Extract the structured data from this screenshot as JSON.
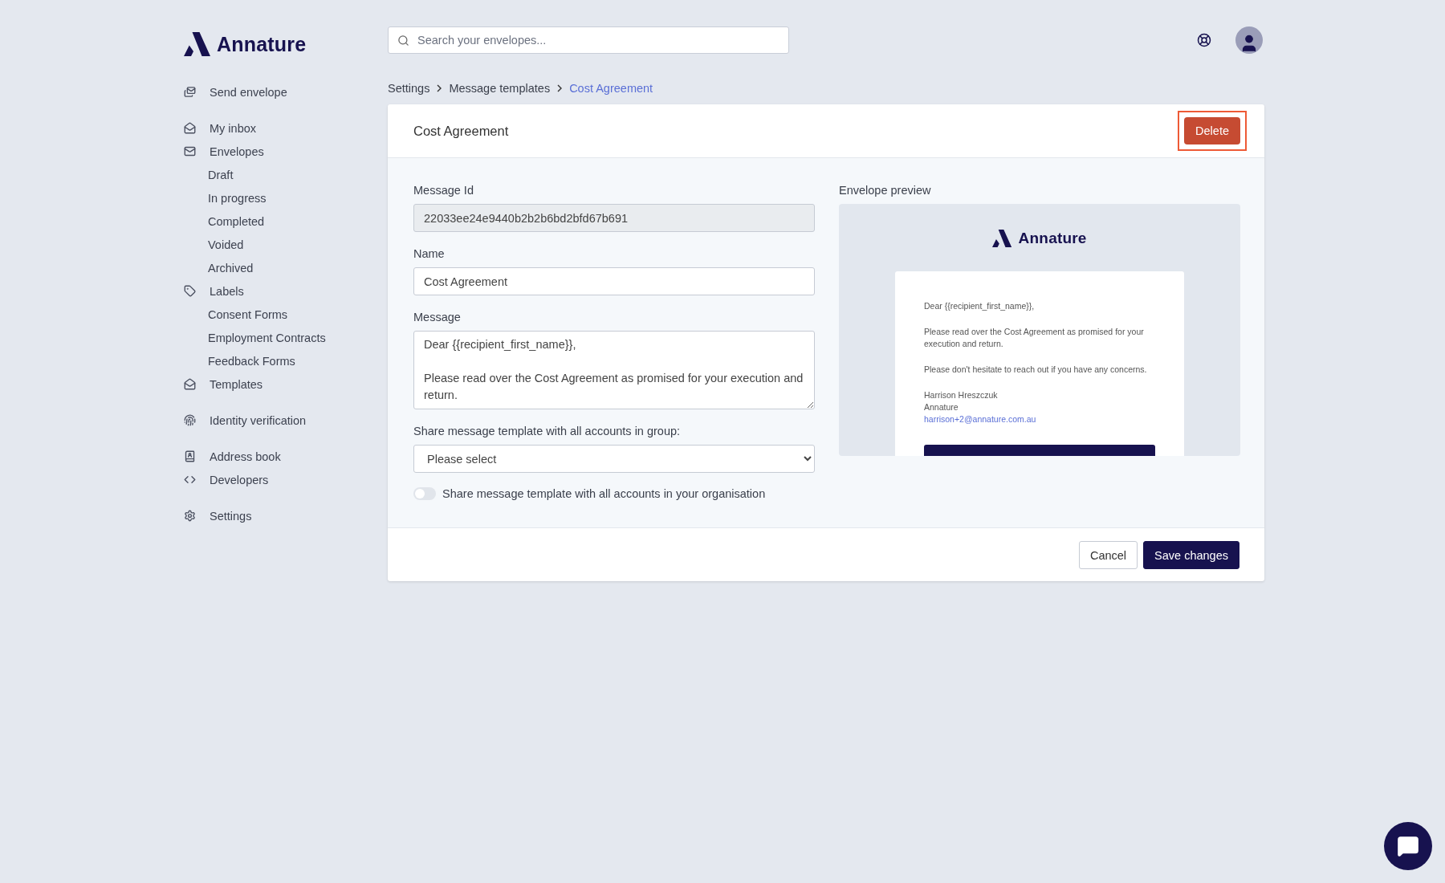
{
  "brand": "Annature",
  "search": {
    "placeholder": "Search your envelopes..."
  },
  "sidebar": {
    "groups": [
      [
        {
          "label": "Send envelope"
        }
      ],
      [
        {
          "label": "My inbox"
        },
        {
          "label": "Envelopes",
          "children": [
            {
              "label": "Draft"
            },
            {
              "label": "In progress"
            },
            {
              "label": "Completed"
            },
            {
              "label": "Voided"
            },
            {
              "label": "Archived"
            }
          ]
        },
        {
          "label": "Labels",
          "children": [
            {
              "label": "Consent Forms"
            },
            {
              "label": "Employment Contracts"
            },
            {
              "label": "Feedback Forms"
            }
          ]
        },
        {
          "label": "Templates"
        }
      ],
      [
        {
          "label": "Identity verification"
        }
      ],
      [
        {
          "label": "Address book"
        },
        {
          "label": "Developers"
        }
      ],
      [
        {
          "label": "Settings"
        }
      ]
    ]
  },
  "breadcrumb": [
    {
      "label": "Settings",
      "selected": false
    },
    {
      "label": "Message templates",
      "selected": false
    },
    {
      "label": "Cost Agreement",
      "selected": true
    }
  ],
  "card": {
    "title": "Cost Agreement",
    "delete_button": {
      "label": "Delete",
      "highlighted": true
    },
    "fields": [
      {
        "kind": "input",
        "label": "Message Id",
        "value": "22033ee24e9440b2b2b6bd2bfd67b691",
        "disabled": true
      },
      {
        "kind": "input",
        "label": "Name",
        "value": "Cost Agreement",
        "disabled": false
      },
      {
        "kind": "textarea",
        "label": "Message",
        "value": "Dear {{recipient_first_name}},\n\nPlease read over the Cost Agreement as promised for your execution and return."
      },
      {
        "kind": "select",
        "label": "Share message template with all accounts in group:",
        "value": "Please select"
      }
    ],
    "toggle": {
      "label": "Share message template with all accounts in your organisation",
      "on": false
    },
    "preview": {
      "label": "Envelope preview",
      "brand": "Annature",
      "paragraphs": [
        "Dear {{recipient_first_name}},",
        "Please read over the Cost Agreement as promised for your execution and return.",
        "Please don't hesitate to reach out if you have any concerns."
      ],
      "signature": [
        "Harrison Hreszczuk",
        "Annature"
      ],
      "email": "harrison+2@annature.com.au"
    },
    "buttons": [
      {
        "kind": "secondary",
        "label": "Cancel"
      },
      {
        "kind": "primary",
        "label": "Save changes"
      }
    ]
  }
}
